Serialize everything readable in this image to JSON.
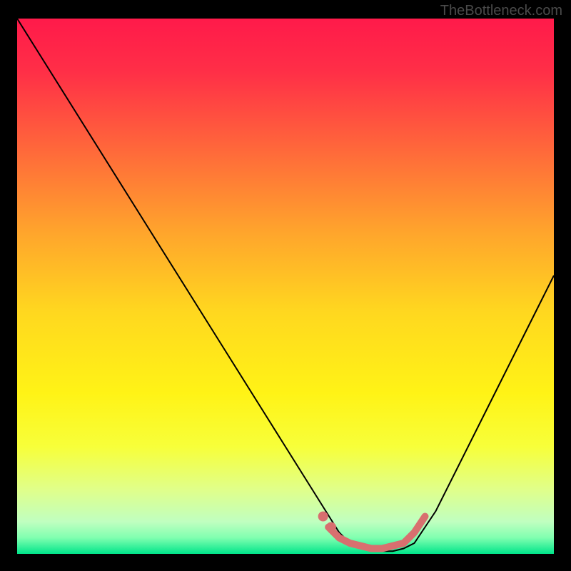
{
  "watermark": "TheBottleneck.com",
  "chart_data": {
    "type": "line",
    "title": "",
    "xlabel": "",
    "ylabel": "",
    "xlim": [
      0,
      100
    ],
    "ylim": [
      0,
      100
    ],
    "grid": false,
    "legend": false,
    "background_gradient": {
      "stops": [
        {
          "offset": 0.0,
          "color": "#ff1a4a"
        },
        {
          "offset": 0.1,
          "color": "#ff2f47"
        },
        {
          "offset": 0.25,
          "color": "#ff6a3a"
        },
        {
          "offset": 0.4,
          "color": "#ffa52c"
        },
        {
          "offset": 0.55,
          "color": "#ffd81f"
        },
        {
          "offset": 0.7,
          "color": "#fff316"
        },
        {
          "offset": 0.8,
          "color": "#f7ff3a"
        },
        {
          "offset": 0.88,
          "color": "#e0ff8a"
        },
        {
          "offset": 0.94,
          "color": "#c0ffc0"
        },
        {
          "offset": 0.97,
          "color": "#80ffb0"
        },
        {
          "offset": 1.0,
          "color": "#00e58a"
        }
      ]
    },
    "series": [
      {
        "name": "bottleneck-curve",
        "color": "#000000",
        "stroke_width": 2,
        "x": [
          0,
          5,
          10,
          15,
          20,
          25,
          30,
          35,
          40,
          45,
          50,
          55,
          60,
          62,
          64,
          66,
          68,
          70,
          72,
          74,
          78,
          82,
          86,
          90,
          94,
          98,
          100
        ],
        "y": [
          100,
          92,
          84,
          76,
          68,
          60,
          52,
          44,
          36,
          28,
          20,
          12,
          4,
          2,
          1,
          0.5,
          0.5,
          0.5,
          1,
          2,
          8,
          16,
          24,
          32,
          40,
          48,
          52
        ]
      },
      {
        "name": "optimal-range-highlight",
        "color": "#d86f6f",
        "stroke_width": 10,
        "linecap": "round",
        "x": [
          58,
          60,
          62,
          64,
          66,
          68,
          70,
          72,
          74,
          76
        ],
        "y": [
          5,
          3,
          2,
          1.5,
          1,
          1,
          1.5,
          2,
          4,
          7
        ]
      },
      {
        "name": "optimal-range-dots",
        "type": "scatter",
        "color": "#d86f6f",
        "marker_size": 7,
        "x": [
          57,
          58.5
        ],
        "y": [
          7,
          5
        ]
      }
    ]
  }
}
